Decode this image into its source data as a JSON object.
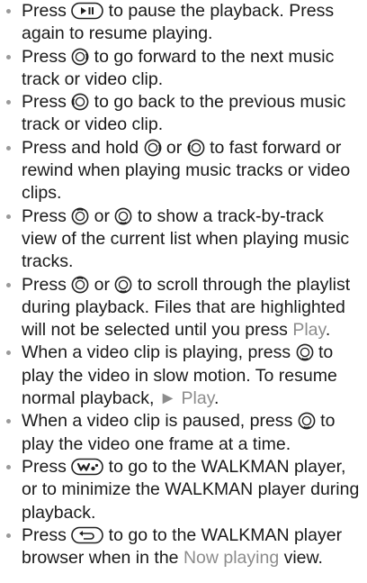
{
  "items": [
    {
      "a": "Press ",
      "b": " to pause the playback. Press again to resume playing."
    },
    {
      "a": "Press ",
      "b": " to go forward to the next music track or video clip."
    },
    {
      "a": "Press ",
      "b": " to go back to the previous music track or video clip."
    },
    {
      "a": "Press and hold ",
      "b": " or ",
      "c": " to fast forward or rewind when playing music tracks or video clips."
    },
    {
      "a": "Press ",
      "b": " or ",
      "c": " to show a track-by-track view of the current list when playing music tracks."
    },
    {
      "a": "Press ",
      "b": " or ",
      "c": " to scroll through the playlist during playback. Files that are highlighted will not be selected until you press ",
      "hl": "Play",
      "d": "."
    },
    {
      "a": "When a video clip is playing, press ",
      "b": " to play the video in slow motion. To resume normal playback, ",
      "hl": "► Play",
      "d": "."
    },
    {
      "a": "When a video clip is paused, press ",
      "b": " to play the video one frame at a time."
    },
    {
      "a": "Press ",
      "b": " to go to the WALKMAN player, or to minimize the WALKMAN player during playback."
    },
    {
      "a": "Press ",
      "b": " to go to the WALKMAN player browser when in the ",
      "hl": "Now playing",
      "d": " view."
    }
  ],
  "icons": {
    "play_pause": "play-pause-key-icon",
    "nav_right": "navigation-key-right-icon",
    "nav_left": "navigation-key-left-icon",
    "nav_up": "navigation-key-up-icon",
    "nav_down": "navigation-key-down-icon",
    "walkman": "walkman-key-icon",
    "back": "back-key-icon"
  }
}
